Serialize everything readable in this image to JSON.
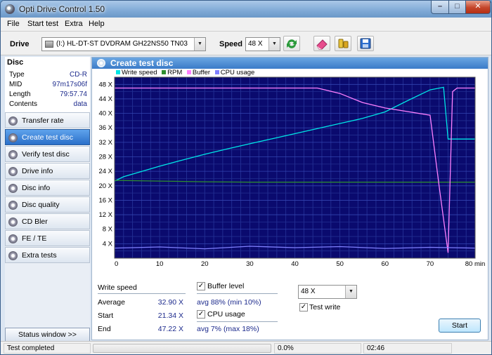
{
  "window": {
    "title": "Opti Drive Control 1.50"
  },
  "menu": [
    "File",
    "Start test",
    "Extra",
    "Help"
  ],
  "toolbar": {
    "drive_label": "Drive",
    "drive_value": "(I:)  HL-DT-ST DVDRAM GH22NS50 TN03",
    "speed_label": "Speed",
    "speed_value": "48 X",
    "icons": [
      "refresh-icon",
      "eraser-icon",
      "tools-icon",
      "save-icon"
    ]
  },
  "disc": {
    "heading": "Disc",
    "fields": [
      {
        "key": "Type",
        "value": "CD-R"
      },
      {
        "key": "MID",
        "value": "97m17s06f"
      },
      {
        "key": "Length",
        "value": "79:57.74"
      },
      {
        "key": "Contents",
        "value": "data"
      }
    ]
  },
  "nav": [
    {
      "label": "Transfer rate",
      "active": false
    },
    {
      "label": "Create test disc",
      "active": true
    },
    {
      "label": "Verify test disc",
      "active": false
    },
    {
      "label": "Drive info",
      "active": false
    },
    {
      "label": "Disc info",
      "active": false
    },
    {
      "label": "Disc quality",
      "active": false
    },
    {
      "label": "CD Bler",
      "active": false
    },
    {
      "label": "FE / TE",
      "active": false
    },
    {
      "label": "Extra tests",
      "active": false
    }
  ],
  "status_window_label": "Status window >>",
  "panel": {
    "title": "Create test disc"
  },
  "chart_data": {
    "type": "line",
    "legend": [
      {
        "name": "Write speed",
        "color": "#00e5e5"
      },
      {
        "name": "RPM",
        "color": "#2f8f2f"
      },
      {
        "name": "Buffer",
        "color": "#ff80ff"
      },
      {
        "name": "CPU usage",
        "color": "#8080ff"
      }
    ],
    "xlim": [
      0,
      80
    ],
    "ylim": [
      0,
      50
    ],
    "x_ticks": [
      "0",
      "10",
      "20",
      "30",
      "40",
      "50",
      "60",
      "70",
      "80 min"
    ],
    "y_ticks": [
      "4 X",
      "8 X",
      "12 X",
      "16 X",
      "20 X",
      "24 X",
      "28 X",
      "32 X",
      "36 X",
      "40 X",
      "44 X",
      "48 X"
    ],
    "y_tick_values": [
      4,
      8,
      12,
      16,
      20,
      24,
      28,
      32,
      36,
      40,
      44,
      48
    ],
    "grid": true,
    "background": "#0a0a6e",
    "series": [
      {
        "name": "Write speed",
        "x": [
          0,
          2,
          5,
          10,
          15,
          20,
          25,
          30,
          35,
          40,
          45,
          50,
          55,
          60,
          65,
          70,
          73,
          74,
          75,
          80
        ],
        "y": [
          21.3,
          22.5,
          23.6,
          25.4,
          27.1,
          28.7,
          30.2,
          31.6,
          33.0,
          34.4,
          35.8,
          37.2,
          38.6,
          40.4,
          43.5,
          46.5,
          47.2,
          32.9,
          32.9,
          32.9
        ]
      },
      {
        "name": "RPM",
        "x": [
          0,
          10,
          20,
          30,
          40,
          50,
          60,
          70,
          80
        ],
        "y": [
          21.5,
          21.3,
          21.1,
          21.0,
          21.0,
          21.0,
          21.0,
          21.0,
          21.0
        ]
      },
      {
        "name": "Buffer",
        "x": [
          0,
          5,
          10,
          20,
          30,
          40,
          45,
          50,
          55,
          60,
          65,
          70,
          72,
          74,
          75,
          76,
          80
        ],
        "y": [
          47,
          47,
          47,
          47,
          47,
          47,
          47,
          45.5,
          43,
          41.5,
          40.5,
          39.5,
          20,
          1.5,
          46,
          47,
          47
        ]
      },
      {
        "name": "CPU usage",
        "x": [
          0,
          10,
          20,
          30,
          40,
          50,
          60,
          70,
          80
        ],
        "y": [
          2.8,
          3.1,
          2.6,
          3.3,
          2.9,
          3.2,
          2.7,
          3.0,
          2.8
        ]
      }
    ]
  },
  "stats": {
    "write_speed_label": "Write speed",
    "average_label": "Average",
    "average_value": "32.90 X",
    "start_label": "Start",
    "start_value": "21.34 X",
    "end_label": "End",
    "end_value": "47.22 X",
    "buffer_label": "Buffer level",
    "buffer_checked": "✓",
    "buffer_value": "avg 88% (min 10%)",
    "cpu_label": "CPU usage",
    "cpu_checked": "✓",
    "cpu_value": "avg 7% (max 18%)",
    "speed_select": "48 X",
    "test_write_label": "Test write",
    "test_write_checked": "✓",
    "start_button": "Start"
  },
  "statusbar": {
    "message": "Test completed",
    "progress_text": "0.0%",
    "progress_fraction": 0.0,
    "elapsed": "02:46"
  }
}
